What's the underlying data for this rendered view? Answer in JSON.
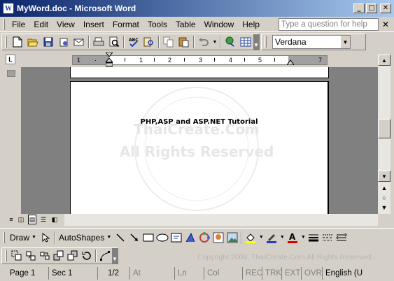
{
  "window": {
    "title": "MyWord.doc - Microsoft Word",
    "app_icon_letter": "W",
    "minimize_glyph": "_",
    "maximize_glyph": "□",
    "close_glyph": "✕"
  },
  "menu": {
    "items": [
      {
        "label": "File",
        "underline": "F",
        "rest": "ile"
      },
      {
        "label": "Edit",
        "underline": "E",
        "rest": "dit"
      },
      {
        "label": "View",
        "underline": "V",
        "rest": "iew"
      },
      {
        "label": "Insert",
        "underline": "I",
        "rest": "nsert"
      },
      {
        "label": "Format",
        "underline": "o",
        "pre": "F",
        "rest": "rmat"
      },
      {
        "label": "Tools",
        "underline": "T",
        "rest": "ools"
      },
      {
        "label": "Table",
        "underline": "a",
        "pre": "T",
        "rest": "ble"
      },
      {
        "label": "Window",
        "underline": "W",
        "rest": "indow"
      },
      {
        "label": "Help",
        "underline": "H",
        "rest": "elp"
      }
    ],
    "help_placeholder": "Type a question for help",
    "doc_close_glyph": "✕"
  },
  "toolbar": {
    "font_name": "Verdana",
    "icons": [
      "new-icon",
      "open-icon",
      "save-icon",
      "permission-icon",
      "email-icon",
      "print-icon",
      "print-preview-icon",
      "spelling-icon",
      "research-icon",
      "copy-icon",
      "paste-icon",
      "undo-icon",
      "hyperlink-icon",
      "table-icon"
    ]
  },
  "ruler": {
    "numbers": [
      "1",
      "1",
      "1",
      "2",
      "3",
      "4",
      "5",
      "7"
    ]
  },
  "document": {
    "heading": "PHP,ASP and ASP.NET Tutorial",
    "watermark_line1": "ThaiCreate.Com",
    "watermark_line2": "All Rights Reserved"
  },
  "drawing_toolbar": {
    "draw_label": "Draw",
    "autoshapes_label": "AutoShapes"
  },
  "copyright": "Copyright 2009, ThaiCreate.Com  All Rights Reserved.",
  "status": {
    "page": "Page 1",
    "sec": "Sec 1",
    "page_of": "1/2",
    "at": "At",
    "ln": "Ln",
    "col": "Col",
    "rec": "REC",
    "trk": "TRK",
    "ext": "EXT",
    "ovr": "OVR",
    "language": "English (U"
  },
  "colors": {
    "title_start": "#0a246a",
    "title_end": "#a6caf0",
    "chrome": "#d4d0c8",
    "canvas": "#808080"
  }
}
